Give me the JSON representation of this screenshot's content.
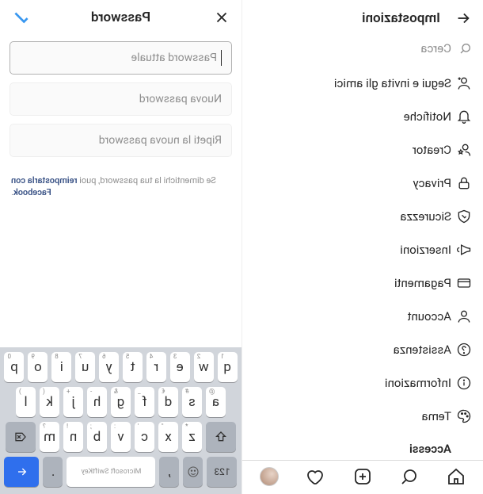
{
  "settings": {
    "title": "Impostazioni",
    "search_placeholder": "Cerca",
    "items": [
      {
        "label": "Segui e invita gli amici"
      },
      {
        "label": "Notifiche"
      },
      {
        "label": "Creator"
      },
      {
        "label": "Privacy"
      },
      {
        "label": "Sicurezza"
      },
      {
        "label": "Inserzioni"
      },
      {
        "label": "Pagamenti"
      },
      {
        "label": "Account"
      },
      {
        "label": "Assistenza"
      },
      {
        "label": "Informazioni"
      },
      {
        "label": "Tema"
      },
      {
        "label": "Accessi"
      }
    ]
  },
  "password": {
    "title": "Password",
    "current_placeholder": "Password attuale",
    "new_placeholder": "Nuova password",
    "repeat_placeholder": "Ripeti la nuova password",
    "hint_prefix": "Se dimentichi la tua password, puoi ",
    "hint_link": "reimpostarla con Facebook",
    "hint_suffix": "."
  },
  "keyboard": {
    "row1": [
      {
        "m": "q",
        "s": "1"
      },
      {
        "m": "w",
        "s": "2"
      },
      {
        "m": "e",
        "s": "3"
      },
      {
        "m": "r",
        "s": "4"
      },
      {
        "m": "t",
        "s": "5"
      },
      {
        "m": "y",
        "s": "6"
      },
      {
        "m": "u",
        "s": "7"
      },
      {
        "m": "i",
        "s": "8"
      },
      {
        "m": "o",
        "s": "9"
      },
      {
        "m": "p",
        "s": "0"
      }
    ],
    "row2": [
      {
        "m": "a",
        "s": "@"
      },
      {
        "m": "s",
        "s": "#"
      },
      {
        "m": "d",
        "s": "€"
      },
      {
        "m": "f",
        "s": "_"
      },
      {
        "m": "g",
        "s": "&"
      },
      {
        "m": "h",
        "s": "-"
      },
      {
        "m": "j",
        "s": "+"
      },
      {
        "m": "k",
        "s": "("
      },
      {
        "m": "l",
        "s": ")"
      }
    ],
    "row3": [
      {
        "m": "z",
        "s": "*"
      },
      {
        "m": "x",
        "s": "\""
      },
      {
        "m": "c",
        "s": "'"
      },
      {
        "m": "v",
        "s": ":"
      },
      {
        "m": "b",
        "s": ";"
      },
      {
        "m": "n",
        "s": "!"
      },
      {
        "m": "m",
        "s": "?"
      }
    ],
    "sym": "123",
    "comma": ",",
    "space": "Microsoft SwiftKey",
    "period": "."
  }
}
